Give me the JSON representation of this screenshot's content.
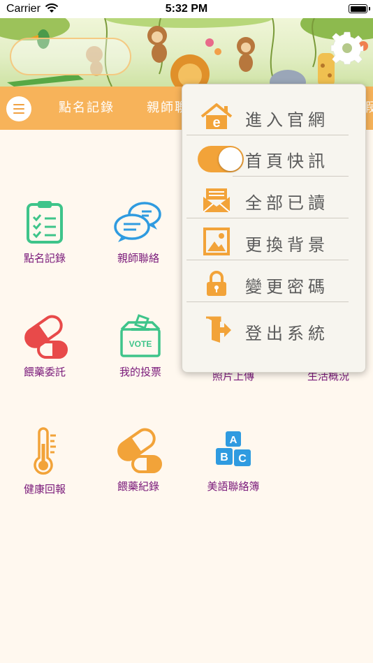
{
  "status_bar": {
    "carrier": "Carrier",
    "time": "5:32 PM"
  },
  "nav": {
    "tabs": [
      "點名記錄",
      "親師聯",
      "假"
    ]
  },
  "grid": {
    "items": [
      {
        "label": "點名記錄",
        "icon": "clipboard-checklist-icon"
      },
      {
        "label": "親師聯絡",
        "icon": "chat-bubbles-icon"
      },
      {
        "label": "餵藥委託",
        "icon": "medicine-capsule-icon"
      },
      {
        "label": "我的投票",
        "icon": "vote-box-icon"
      },
      {
        "label": "照片上傳",
        "icon": "photo-upload-icon"
      },
      {
        "label": "生活概況",
        "icon": "life-overview-icon"
      },
      {
        "label": "健康回報",
        "icon": "thermometer-icon"
      },
      {
        "label": "餵藥紀錄",
        "icon": "medicine-record-icon"
      },
      {
        "label": "美語聯絡簿",
        "icon": "abc-blocks-icon"
      }
    ]
  },
  "menu": {
    "items": [
      {
        "label": "進入官網",
        "icon": "home-e-icon"
      },
      {
        "label": "首頁快訊",
        "icon": "toggle-switch",
        "toggle_on": true
      },
      {
        "label": "全部已讀",
        "icon": "envelope-icon"
      },
      {
        "label": "更換背景",
        "icon": "picture-icon"
      },
      {
        "label": "變更密碼",
        "icon": "lock-icon"
      },
      {
        "label": "登出系統",
        "icon": "logout-door-icon"
      }
    ]
  },
  "colors": {
    "accent": "#f7b35a",
    "label": "#7a1a7a",
    "icon_green": "#3ec48a",
    "icon_blue": "#2f9be0",
    "icon_red": "#e84a4a",
    "icon_orange": "#f2a339",
    "toggle": "#f2a339"
  }
}
